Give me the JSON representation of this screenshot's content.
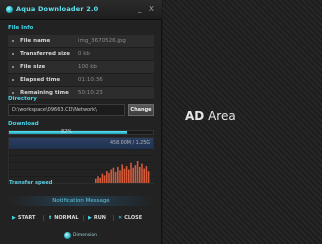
{
  "window": {
    "title": "Aqua Downloader 2.0",
    "minimize_label": "_",
    "close_label": "X"
  },
  "sections": {
    "file_info": "File Info",
    "directory": "Directory",
    "download": "Download",
    "transfer_speed": "Transfer speed"
  },
  "file_info": {
    "rows": [
      {
        "label": "File name",
        "value": "img_3670526.jpg"
      },
      {
        "label": "Transferred size",
        "value": "0 kb"
      },
      {
        "label": "File size",
        "value": "100 kb"
      },
      {
        "label": "Elapsed time",
        "value": "01:10:36"
      },
      {
        "label": "Remaining time",
        "value": "50:10:23"
      }
    ]
  },
  "directory": {
    "path": "D:\\workspace\\09663.CD\\Network\\",
    "change_label": "Change"
  },
  "download": {
    "percent_text": "82%",
    "progress": 0.82,
    "speed_readout": "458.00M / 1.25G"
  },
  "speed_graph": {
    "bars": [
      5,
      8,
      6,
      11,
      9,
      14,
      12,
      16,
      18,
      13,
      19,
      15,
      22,
      17,
      20,
      16,
      24,
      18,
      21,
      26,
      19,
      23,
      17,
      20,
      14
    ]
  },
  "notification": "Notification Message",
  "controls": {
    "start": "START",
    "normal": "NORMAL",
    "run": "RUN",
    "close": "CLOSE"
  },
  "footer_logo": "Dimension",
  "ad": {
    "bold": "AD",
    "rest": " Area"
  },
  "colors": {
    "accent": "#44d6ea",
    "progress": "#5fe4f6",
    "graph": "#d35a3a"
  }
}
